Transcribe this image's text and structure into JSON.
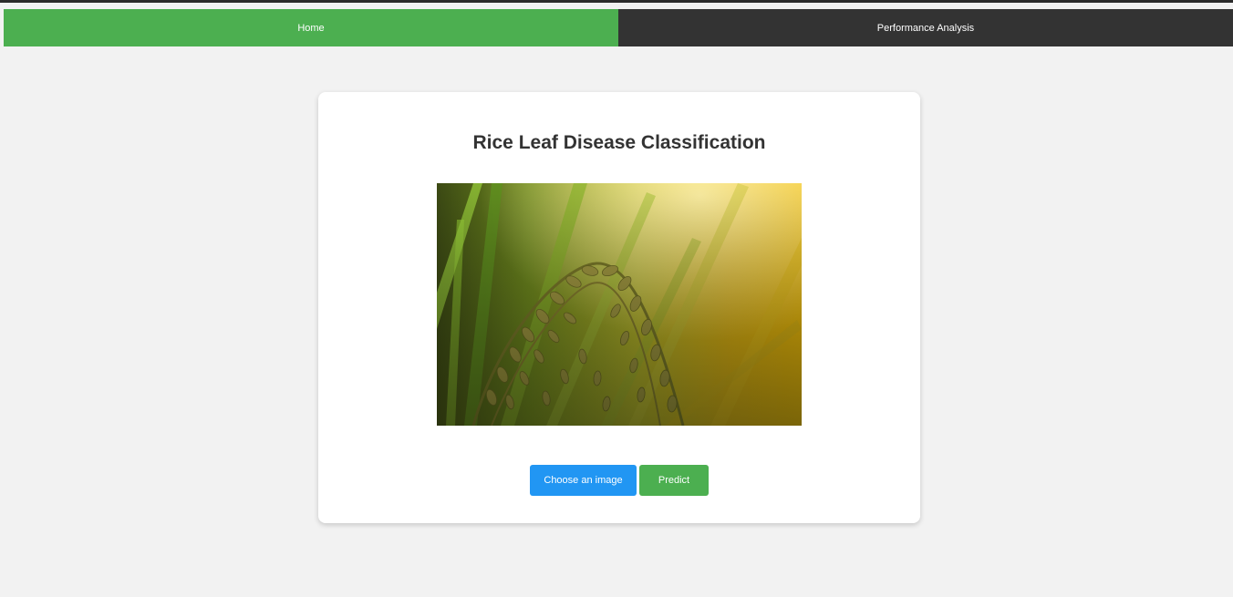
{
  "nav": {
    "tabs": [
      {
        "label": "Home",
        "active": true
      },
      {
        "label": "Performance Analysis",
        "active": false
      }
    ]
  },
  "main": {
    "title": "Rice Leaf Disease Classification",
    "image": {
      "subject": "rice-plant-grains"
    },
    "buttons": {
      "choose_label": "Choose an image",
      "predict_label": "Predict"
    }
  },
  "colors": {
    "accent_green": "#4caf50",
    "nav_dark": "#333333",
    "choose_blue": "#2196f3",
    "page_bg": "#f2f2f2",
    "title_text": "#333333"
  }
}
